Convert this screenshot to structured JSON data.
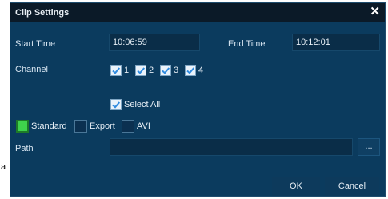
{
  "dialog": {
    "title": "Clip Settings"
  },
  "fields": {
    "start_time_label": "Start Time",
    "start_time_value": "10:06:59",
    "end_time_label": "End Time",
    "end_time_value": "10:12:01",
    "channel_label": "Channel",
    "path_label": "Path",
    "path_value": ""
  },
  "channels": [
    {
      "label": "1",
      "checked": true
    },
    {
      "label": "2",
      "checked": true
    },
    {
      "label": "3",
      "checked": true
    },
    {
      "label": "4",
      "checked": true
    }
  ],
  "select_all": {
    "label": "Select All",
    "checked": true
  },
  "formats": [
    {
      "label": "Standard",
      "selected": true
    },
    {
      "label": "Export",
      "selected": false
    },
    {
      "label": "AVI",
      "selected": false
    }
  ],
  "buttons": {
    "browse": "...",
    "ok": "OK",
    "cancel": "Cancel"
  },
  "colors": {
    "background": "#0b3b5e",
    "titlebar": "#0b1a28",
    "check": "#2f8be0",
    "selected": "#3fd24c"
  },
  "side_text": "a"
}
